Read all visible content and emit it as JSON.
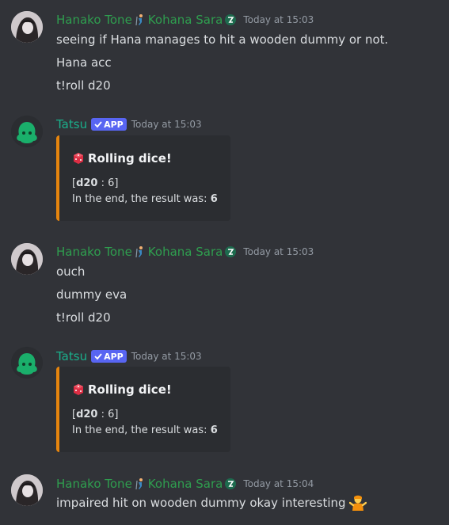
{
  "messages": [
    {
      "author": "Hanako Tone",
      "author_suffix": "Kohana Sara",
      "timestamp": "Today at 15:03",
      "lines": [
        "seeing if Hana manages to hit a wooden dummy or not.",
        "Hana acc",
        "t!roll d20"
      ]
    },
    {
      "author": "Tatsu",
      "badge": "APP",
      "timestamp": "Today at 15:03",
      "embed": {
        "title": "Rolling dice!",
        "roll_die": "d20",
        "roll_sep": " : ",
        "roll_value": "6",
        "result_text": "In the end, the result was: ",
        "result_value": "6"
      }
    },
    {
      "author": "Hanako Tone",
      "author_suffix": "Kohana Sara",
      "timestamp": "Today at 15:03",
      "lines": [
        "ouch",
        "dummy eva",
        "t!roll d20"
      ]
    },
    {
      "author": "Tatsu",
      "badge": "APP",
      "timestamp": "Today at 15:03",
      "embed": {
        "title": "Rolling dice!",
        "roll_die": "d20",
        "roll_sep": " : ",
        "roll_value": "6",
        "result_text": "In the end, the result was: ",
        "result_value": "6"
      }
    },
    {
      "author": "Hanako Tone",
      "author_suffix": "Kohana Sara",
      "timestamp": "Today at 15:04",
      "lines": [
        "impaired hit on  wooden dummy okay interesting"
      ]
    }
  ]
}
